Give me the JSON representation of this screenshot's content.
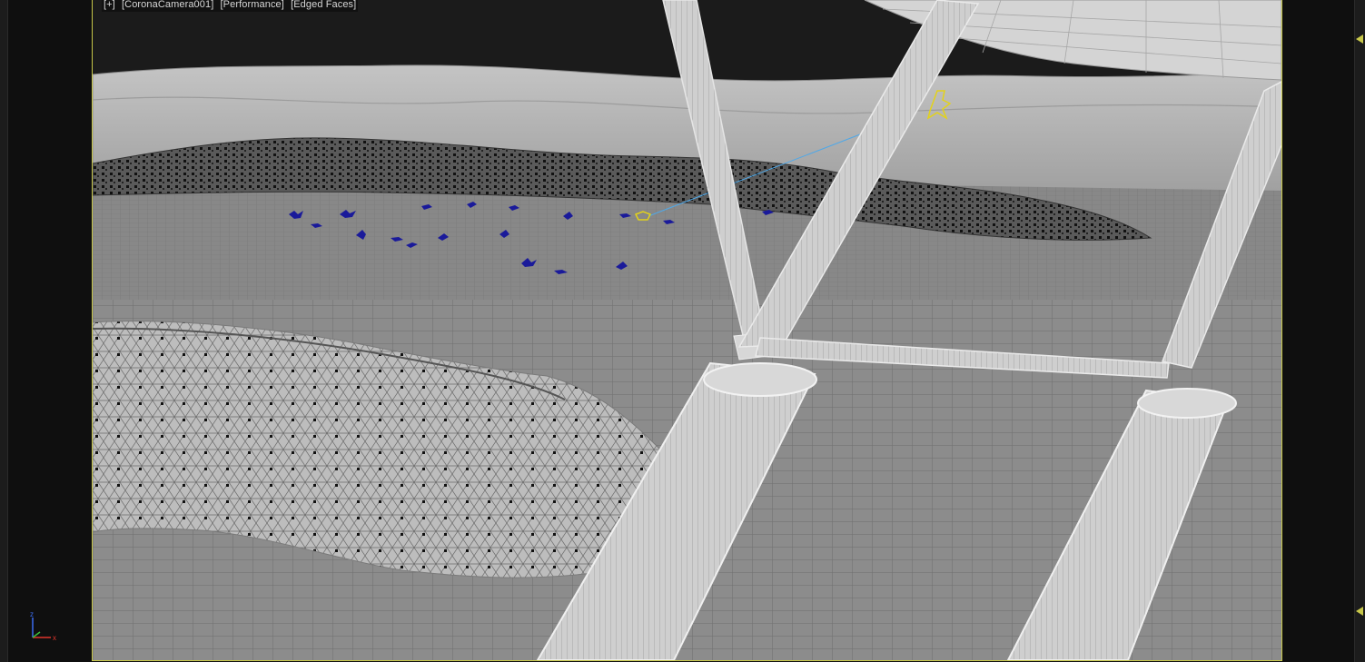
{
  "viewport": {
    "label_menu": "[+]",
    "label_camera": "[CoronaCamera001]",
    "label_mode": "[Performance]",
    "label_shading": "[Edged Faces]"
  },
  "gizmo": {
    "z": "z",
    "x": "x"
  },
  "colors": {
    "active_border": "#c8c84a",
    "ground": "#8f8f8f",
    "mesh_light": "#c9c9c9",
    "birds": "#1a1a9a",
    "selection": "#e3d21a",
    "camera_line": "#4fa8e8"
  }
}
